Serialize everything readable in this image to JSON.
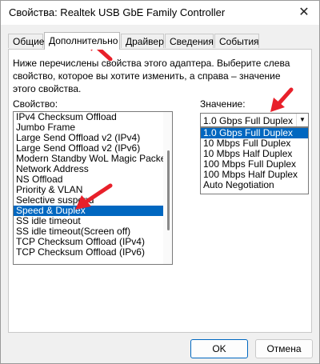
{
  "window": {
    "title": "Свойства: Realtek USB GbE Family Controller",
    "close_glyph": "✕"
  },
  "tabs": [
    {
      "label": "Общие"
    },
    {
      "label": "Дополнительно"
    },
    {
      "label": "Драйвер"
    },
    {
      "label": "Сведения"
    },
    {
      "label": "События"
    }
  ],
  "description": "Ниже перечислены свойства этого адаптера. Выберите слева свойство, которое вы хотите изменить, а справа – значение этого свойства.",
  "property_label": "Свойство:",
  "value_label": "Значение:",
  "properties": [
    {
      "label": "IPv4 Checksum Offload"
    },
    {
      "label": "Jumbo Frame"
    },
    {
      "label": "Large Send Offload v2 (IPv4)"
    },
    {
      "label": "Large Send Offload v2 (IPv6)"
    },
    {
      "label": "Modern Standby WoL Magic Packet"
    },
    {
      "label": "Network Address"
    },
    {
      "label": "NS Offload"
    },
    {
      "label": "Priority & VLAN"
    },
    {
      "label": "Selective suspend"
    },
    {
      "label": "Speed & Duplex"
    },
    {
      "label": "SS idle timeout"
    },
    {
      "label": "SS idle timeout(Screen off)"
    },
    {
      "label": "TCP Checksum Offload (IPv4)"
    },
    {
      "label": "TCP Checksum Offload (IPv6)"
    }
  ],
  "value_combo": {
    "value": "1.0 Gbps Full Duplex",
    "arrow_glyph": "▼"
  },
  "value_options": [
    {
      "label": "1.0 Gbps Full Duplex"
    },
    {
      "label": "10 Mbps Full Duplex"
    },
    {
      "label": "10 Mbps Half Duplex"
    },
    {
      "label": "100 Mbps Full Duplex"
    },
    {
      "label": "100 Mbps Half Duplex"
    },
    {
      "label": "Auto Negotiation"
    }
  ],
  "buttons": {
    "ok": "OK",
    "cancel": "Отмена"
  },
  "colors": {
    "selection": "#0067c0",
    "annotation_arrow": "#e8202a"
  }
}
